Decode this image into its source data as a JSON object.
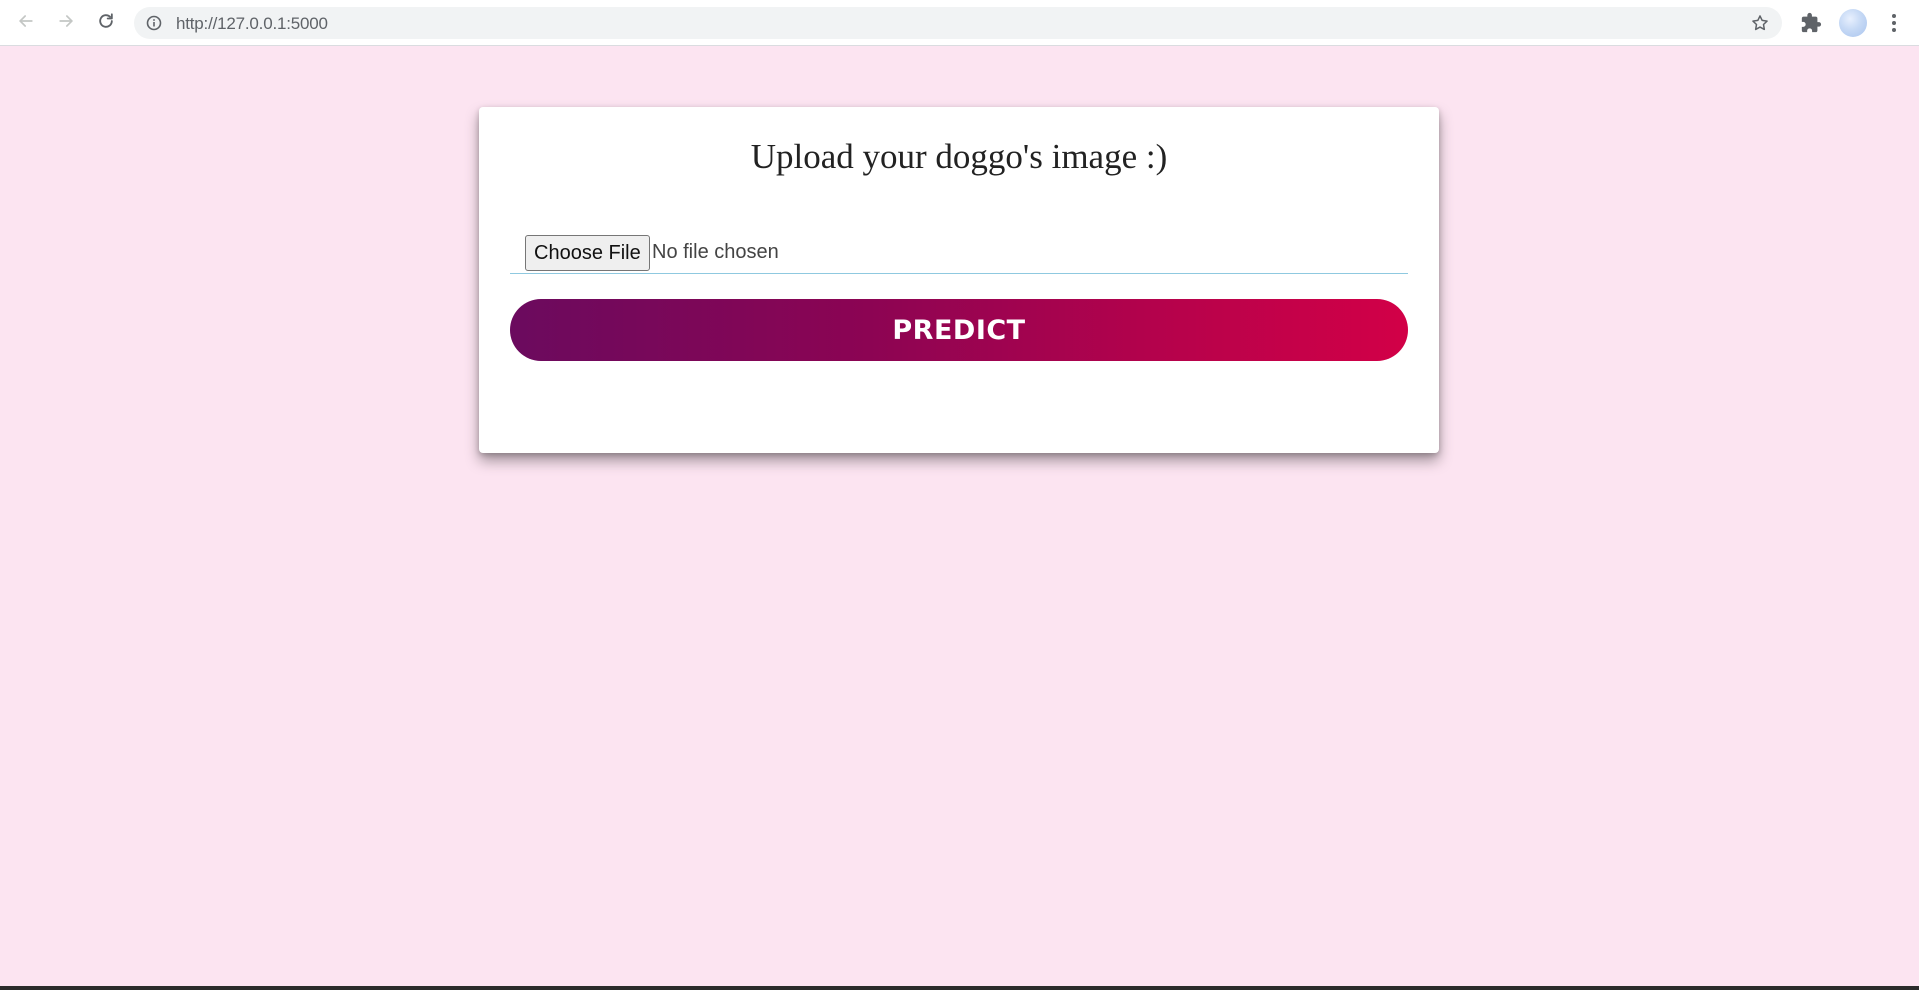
{
  "browser": {
    "url": "http://127.0.0.1:5000"
  },
  "icons": {
    "back": "back-arrow-icon",
    "forward": "forward-arrow-icon",
    "reload": "reload-icon",
    "info": "info-icon",
    "bookmark": "star-icon",
    "extensions": "puzzle-icon",
    "profile": "avatar",
    "menu": "kebab-menu-icon"
  },
  "page": {
    "background_color": "#fce4f1",
    "title": "Upload your doggo's image :)",
    "file_input": {
      "button_label": "Choose File",
      "status": "No file chosen"
    },
    "predict_label": "PREDICT",
    "predict_gradient": [
      "#6b0a5e",
      "#d20047"
    ]
  }
}
